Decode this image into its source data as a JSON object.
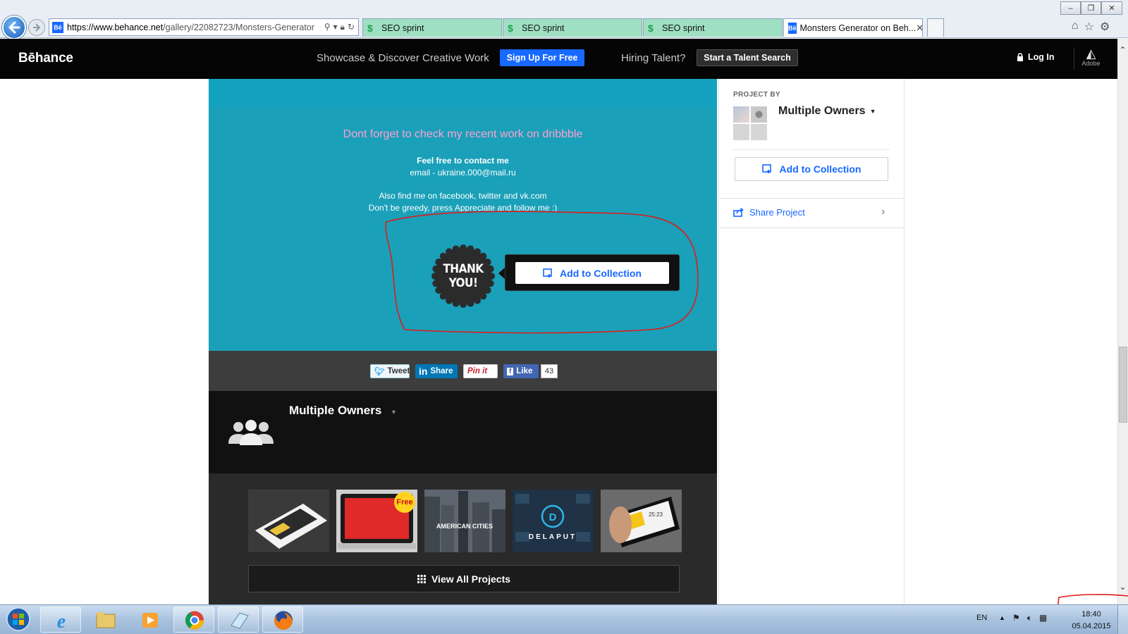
{
  "browser": {
    "window_controls": [
      "–",
      "❐",
      "✕"
    ],
    "address": {
      "url_host": "https://www.behance.net",
      "url_path": "/gallery/22082723/Monsters-Generator"
    },
    "tabs": [
      {
        "label": "SEO sprint"
      },
      {
        "label": "SEO sprint"
      },
      {
        "label": "SEO sprint"
      },
      {
        "label": "Monsters Generator on Beh..."
      }
    ],
    "toolbar_icons": [
      "home-icon",
      "star-icon",
      "gear-icon"
    ]
  },
  "header": {
    "logo": "Bēhance",
    "tagline": "Showcase & Discover Creative Work",
    "signup": "Sign Up For Free",
    "hiring": "Hiring Talent?",
    "talent_search": "Start a Talent Search",
    "login": "Log In",
    "adobe": "Adobe"
  },
  "project": {
    "dribbble_note": "Dont forget to check my recent work on dribbble",
    "contact_line1": "Feel free to contact me",
    "contact_line2": "email - ukraine.000@mail.ru",
    "find_line1": "Also find me on facebook, twitter and vk.com",
    "find_line2": "Don't be greedy, press Appreciate and follow me :)",
    "thank_you": [
      "THANK",
      "YOU!"
    ],
    "add_to_collection": "Add to Collection"
  },
  "share": {
    "tweet": "Tweet",
    "linkedin": "Share",
    "pinterest": "Pin it",
    "facebook": "Like",
    "facebook_count": "43"
  },
  "owners": {
    "name": "Multiple Owners",
    "thumbnails": [
      {
        "text": ""
      },
      {
        "text": "Free"
      },
      {
        "text": "AMERICAN CITIES"
      },
      {
        "text": "DELAPUT"
      },
      {
        "text": "25:23"
      }
    ],
    "view_all": "View All Projects"
  },
  "sidebar": {
    "project_by": "PROJECT BY",
    "owners": "Multiple Owners",
    "add_to_collection": "Add to Collection",
    "share_project": "Share Project"
  },
  "taskbar": {
    "lang": "EN",
    "time": "18:40",
    "date": "05.04.2015"
  },
  "colors": {
    "behance_blue": "#1769ff",
    "teal": "#1aa0b9",
    "annotation_red": "#e01b1b"
  }
}
